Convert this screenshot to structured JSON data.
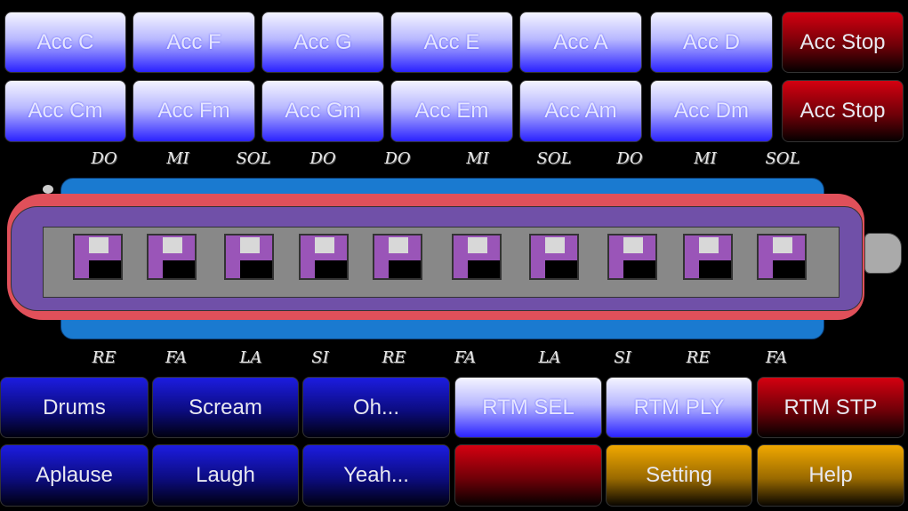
{
  "accordion_row1": [
    "Acc C",
    "Acc F",
    "Acc G",
    "Acc E",
    "Acc A",
    "Acc D",
    "Acc Stop"
  ],
  "accordion_row2": [
    "Acc Cm",
    "Acc Fm",
    "Acc Gm",
    "Acc Em",
    "Acc Am",
    "Acc Dm",
    "Acc Stop"
  ],
  "blow_notes": [
    "DO",
    "MI",
    "SOL",
    "DO",
    "DO",
    "MI",
    "SOL",
    "DO",
    "MI",
    "SOL"
  ],
  "draw_notes": [
    "RE",
    "FA",
    "LA",
    "SI",
    "RE",
    "FA",
    "LA",
    "SI",
    "RE",
    "FA"
  ],
  "bottom_row1": [
    "Drums",
    "Scream",
    "Oh...",
    "RTM SEL",
    "RTM PLY",
    "RTM STP"
  ],
  "bottom_row2": [
    "Aplause",
    "Laugh",
    "Yeah...",
    "",
    "Setting",
    "Help"
  ],
  "colors": {
    "light_blue": "#2a22ff",
    "dark_blue": "#1c1ce0",
    "red": "#d40010",
    "orange": "#f0a800",
    "harmonica_blue": "#1a7ad0",
    "harmonica_red": "#e0505a",
    "harmonica_purple": "#7050a8",
    "harmonica_gray": "#888888"
  }
}
